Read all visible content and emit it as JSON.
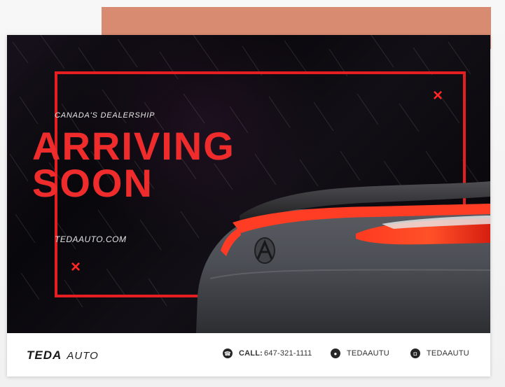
{
  "hero": {
    "kicker": "CANADA'S DEALERSHIP",
    "headline_line1": "ARRIVING",
    "headline_line2": "SOON",
    "website": "TEDAAUTO.COM",
    "accent_color": "#e51e21",
    "corner_mark": "×"
  },
  "footer": {
    "brand_main": "TEDA",
    "brand_sub": "AUTO",
    "call_label": "CALL:",
    "phone": "647-321-1111",
    "wechat": "TEDAAUTU",
    "instagram": "TEDAAUTU",
    "icons": {
      "phone": "phone-icon",
      "wechat": "wechat-icon",
      "instagram": "camera-icon"
    }
  },
  "colors": {
    "background_strip": "#d98b72",
    "headline": "#ef2b2b",
    "hero_dark": "#0b0a0e"
  }
}
